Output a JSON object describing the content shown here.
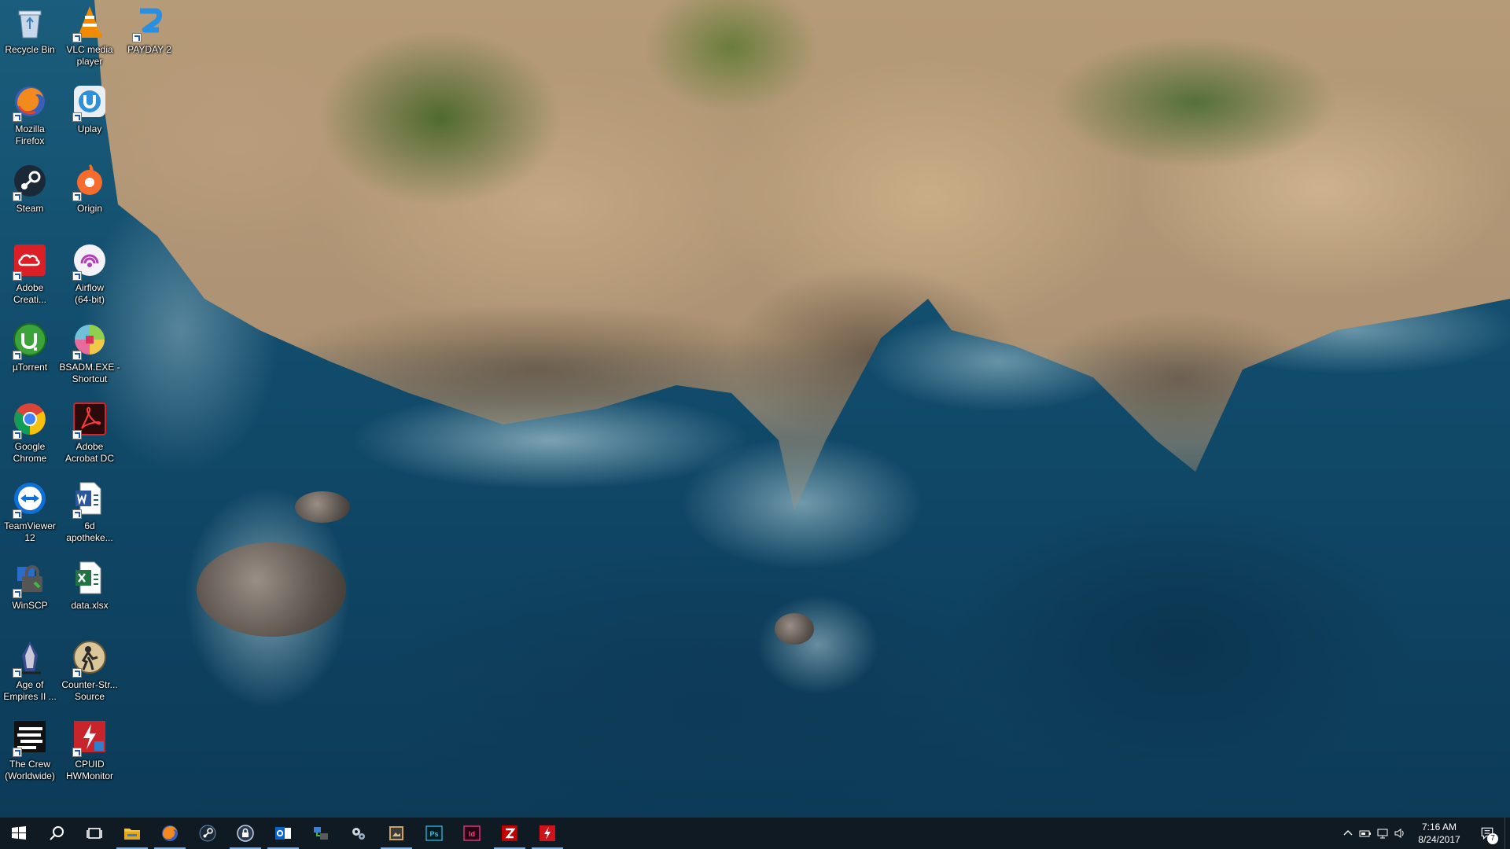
{
  "desktop": {
    "icons": [
      {
        "label": "Recycle Bin",
        "icon": "recycle-bin-icon",
        "shortcut": false
      },
      {
        "label": "VLC media\nplayer",
        "icon": "vlc-icon",
        "shortcut": true
      },
      {
        "label": "PAYDAY 2",
        "icon": "payday2-icon",
        "shortcut": true
      },
      {
        "label": "Mozilla\nFirefox",
        "icon": "firefox-icon",
        "shortcut": true
      },
      {
        "label": "Uplay",
        "icon": "uplay-icon",
        "shortcut": true
      },
      {
        "label": "Steam",
        "icon": "steam-icon",
        "shortcut": true
      },
      {
        "label": "Origin",
        "icon": "origin-icon",
        "shortcut": true
      },
      {
        "label": "Adobe\nCreati...",
        "icon": "adobe-creative-cloud-icon",
        "shortcut": true
      },
      {
        "label": "Airflow\n(64-bit)",
        "icon": "airflow-icon",
        "shortcut": true
      },
      {
        "label": "µTorrent",
        "icon": "utorrent-icon",
        "shortcut": true
      },
      {
        "label": "BSADM.EXE -\nShortcut",
        "icon": "bsadm-icon",
        "shortcut": true
      },
      {
        "label": "Google\nChrome",
        "icon": "chrome-icon",
        "shortcut": true
      },
      {
        "label": "Adobe\nAcrobat DC",
        "icon": "acrobat-icon",
        "shortcut": true
      },
      {
        "label": "TeamViewer\n12",
        "icon": "teamviewer-icon",
        "shortcut": true
      },
      {
        "label": "6d\napotheke...",
        "icon": "word-document-icon",
        "shortcut": true
      },
      {
        "label": "WinSCP",
        "icon": "winscp-icon",
        "shortcut": true
      },
      {
        "label": "data.xlsx",
        "icon": "excel-document-icon",
        "shortcut": false
      },
      {
        "label": "Age of\nEmpires II ...",
        "icon": "age-of-empires-icon",
        "shortcut": true
      },
      {
        "label": "Counter-Str...\nSource",
        "icon": "counter-strike-icon",
        "shortcut": true
      },
      {
        "label": "The Crew\n(Worldwide)",
        "icon": "the-crew-icon",
        "shortcut": true
      },
      {
        "label": "CPUID\nHWMonitor",
        "icon": "hwmonitor-icon",
        "shortcut": true
      }
    ]
  },
  "taskbar": {
    "buttons": [
      {
        "name": "start-button",
        "icon": "windows-logo-icon",
        "active": false
      },
      {
        "name": "search-button",
        "icon": "search-icon",
        "active": false
      },
      {
        "name": "task-view-button",
        "icon": "task-view-icon",
        "active": false
      },
      {
        "name": "file-explorer-button",
        "icon": "folder-icon",
        "active": true
      },
      {
        "name": "firefox-button",
        "icon": "firefox-icon",
        "active": true
      },
      {
        "name": "steam-button",
        "icon": "steam-icon",
        "active": false
      },
      {
        "name": "keepass-button",
        "icon": "lock-icon",
        "active": true
      },
      {
        "name": "outlook-button",
        "icon": "outlook-icon",
        "active": true
      },
      {
        "name": "network-tool-button",
        "icon": "network-icon",
        "active": false
      },
      {
        "name": "settings-tool-button",
        "icon": "gears-icon",
        "active": false
      },
      {
        "name": "app-button",
        "icon": "image-viewer-icon",
        "active": true
      },
      {
        "name": "photoshop-button",
        "icon": "photoshop-icon",
        "active": false
      },
      {
        "name": "indesign-button",
        "icon": "indesign-icon",
        "active": false
      },
      {
        "name": "filezilla-button",
        "icon": "filezilla-icon",
        "active": true
      },
      {
        "name": "flash-app-button",
        "icon": "flash-icon",
        "active": true
      }
    ],
    "photoshop_label": "Ps",
    "indesign_label": "Id",
    "tray": {
      "time": "7:16 AM",
      "date": "8/24/2017",
      "notification_count": "7"
    }
  },
  "colors": {
    "taskbar_bg": "#101a22",
    "active_indicator": "#7fb2e5"
  }
}
